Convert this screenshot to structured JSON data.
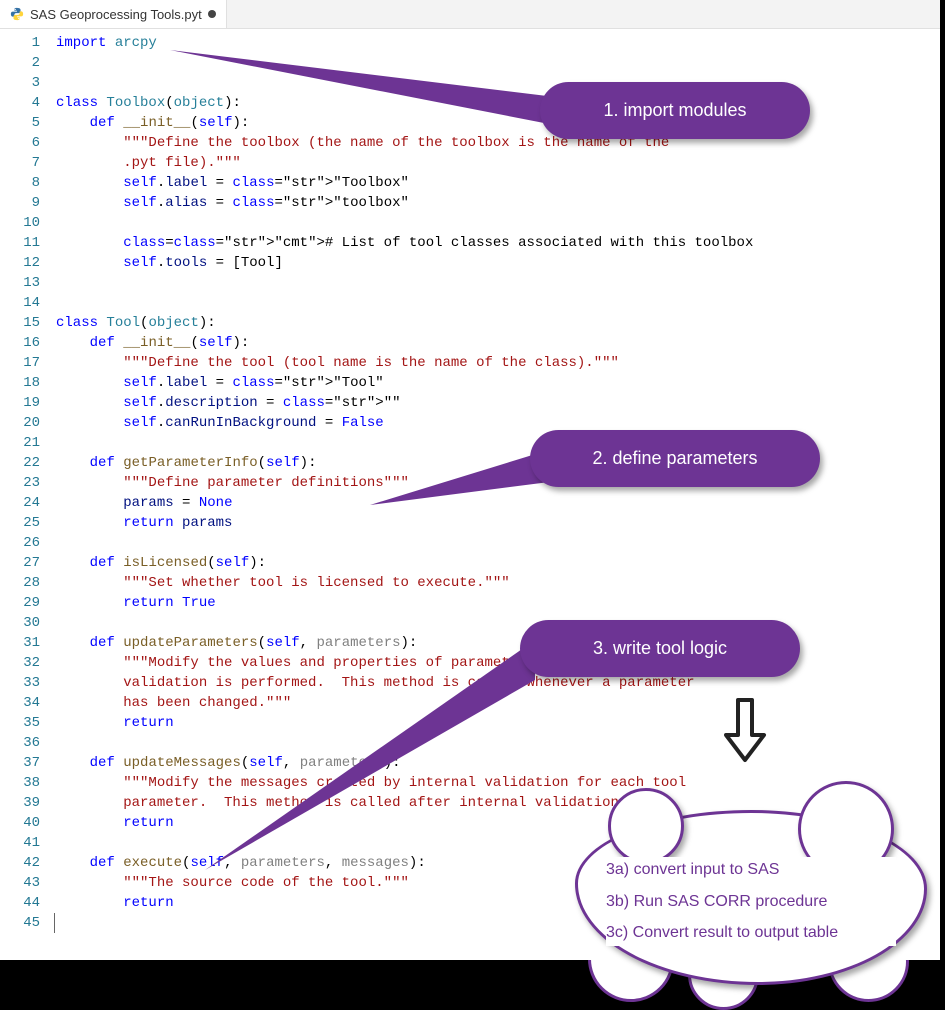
{
  "tab": {
    "filename": "SAS Geoprocessing Tools.pyt",
    "modified": true
  },
  "code": {
    "lines": [
      "import arcpy",
      "",
      "",
      "class Toolbox(object):",
      "    def __init__(self):",
      "        \"\"\"Define the toolbox (the name of the toolbox is the name of the",
      "        .pyt file).\"\"\"",
      "        self.label = \"Toolbox\"",
      "        self.alias = \"toolbox\"",
      "",
      "        # List of tool classes associated with this toolbox",
      "        self.tools = [Tool]",
      "",
      "",
      "class Tool(object):",
      "    def __init__(self):",
      "        \"\"\"Define the tool (tool name is the name of the class).\"\"\"",
      "        self.label = \"Tool\"",
      "        self.description = \"\"",
      "        self.canRunInBackground = False",
      "",
      "    def getParameterInfo(self):",
      "        \"\"\"Define parameter definitions\"\"\"",
      "        params = None",
      "        return params",
      "",
      "    def isLicensed(self):",
      "        \"\"\"Set whether tool is licensed to execute.\"\"\"",
      "        return True",
      "",
      "    def updateParameters(self, parameters):",
      "        \"\"\"Modify the values and properties of parameters before internal",
      "        validation is performed.  This method is called whenever a parameter",
      "        has been changed.\"\"\"",
      "        return",
      "",
      "    def updateMessages(self, parameters):",
      "        \"\"\"Modify the messages created by internal validation for each tool",
      "        parameter.  This method is called after internal validation.\"\"\"",
      "        return",
      "",
      "    def execute(self, parameters, messages):",
      "        \"\"\"The source code of the tool.\"\"\"",
      "        return",
      ""
    ]
  },
  "callouts": {
    "c1": "1. import modules",
    "c2": "2. define parameters",
    "c3": "3. write tool logic"
  },
  "cloud": {
    "a": "3a) convert input to SAS",
    "b": "3b) Run SAS CORR procedure",
    "c": "3c) Convert result to output table"
  },
  "colors": {
    "accent": "#6d3494"
  }
}
